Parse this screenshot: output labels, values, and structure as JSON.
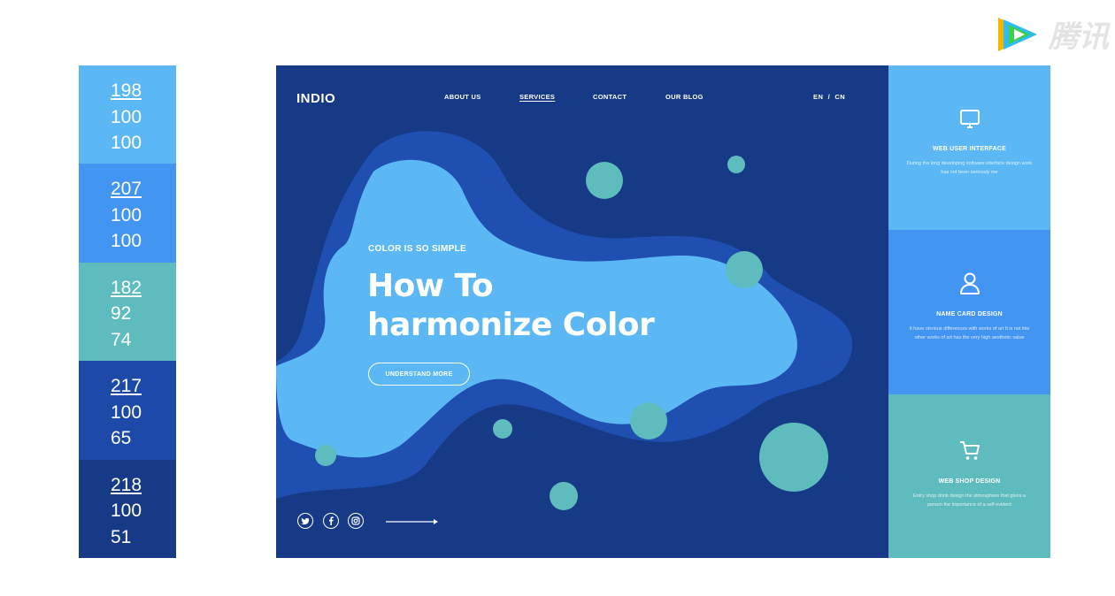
{
  "watermark": {
    "text": "腾讯"
  },
  "palette": [
    {
      "h": "198",
      "s": "100",
      "b": "100",
      "color": "#5cb8f4"
    },
    {
      "h": "207",
      "s": "100",
      "b": "100",
      "color": "#4395f2"
    },
    {
      "h": "182",
      "s": "92",
      "b": "74",
      "color": "#5fbcbe"
    },
    {
      "h": "217",
      "s": "100",
      "b": "65",
      "color": "#1d4aa8"
    },
    {
      "h": "218",
      "s": "100",
      "b": "51",
      "color": "#163a86"
    }
  ],
  "site": {
    "logo": "INDIO",
    "nav": [
      "ABOUT US",
      "SERVICES",
      "CONTACT",
      "OUR BLOG"
    ],
    "active_nav": "SERVICES",
    "lang": "EN  /  CN",
    "eyebrow": "COLOR IS SO SIMPLE",
    "headline_line1": "How To",
    "headline_line2": "harmonize Color",
    "cta": "UNDERSTAND MORE",
    "social_icons": [
      "twitter-icon",
      "facebook-icon",
      "instagram-icon"
    ],
    "colors": {
      "bg": "#163a86",
      "blob_dark": "#1f4fb0",
      "blob_light": "#5cb8f4",
      "dots": "#5fbcbe"
    }
  },
  "cards": [
    {
      "icon": "monitor-icon",
      "title": "WEB USER INTERFACE",
      "desc": "During the long developing software interface design work has not been seriously me",
      "color": "#5cb8f4"
    },
    {
      "icon": "user-icon",
      "title": "NAME CARD DESIGN",
      "desc": "It have obvious differences with works of art It is not like other works of art has the very high aesthetic value",
      "color": "#4395f2"
    },
    {
      "icon": "cart-icon",
      "title": "WEB SHOP DESIGN",
      "desc": "Entry shop drink design the atmosphere that gives a person the importance of a self evident",
      "color": "#5fbcbe"
    }
  ]
}
